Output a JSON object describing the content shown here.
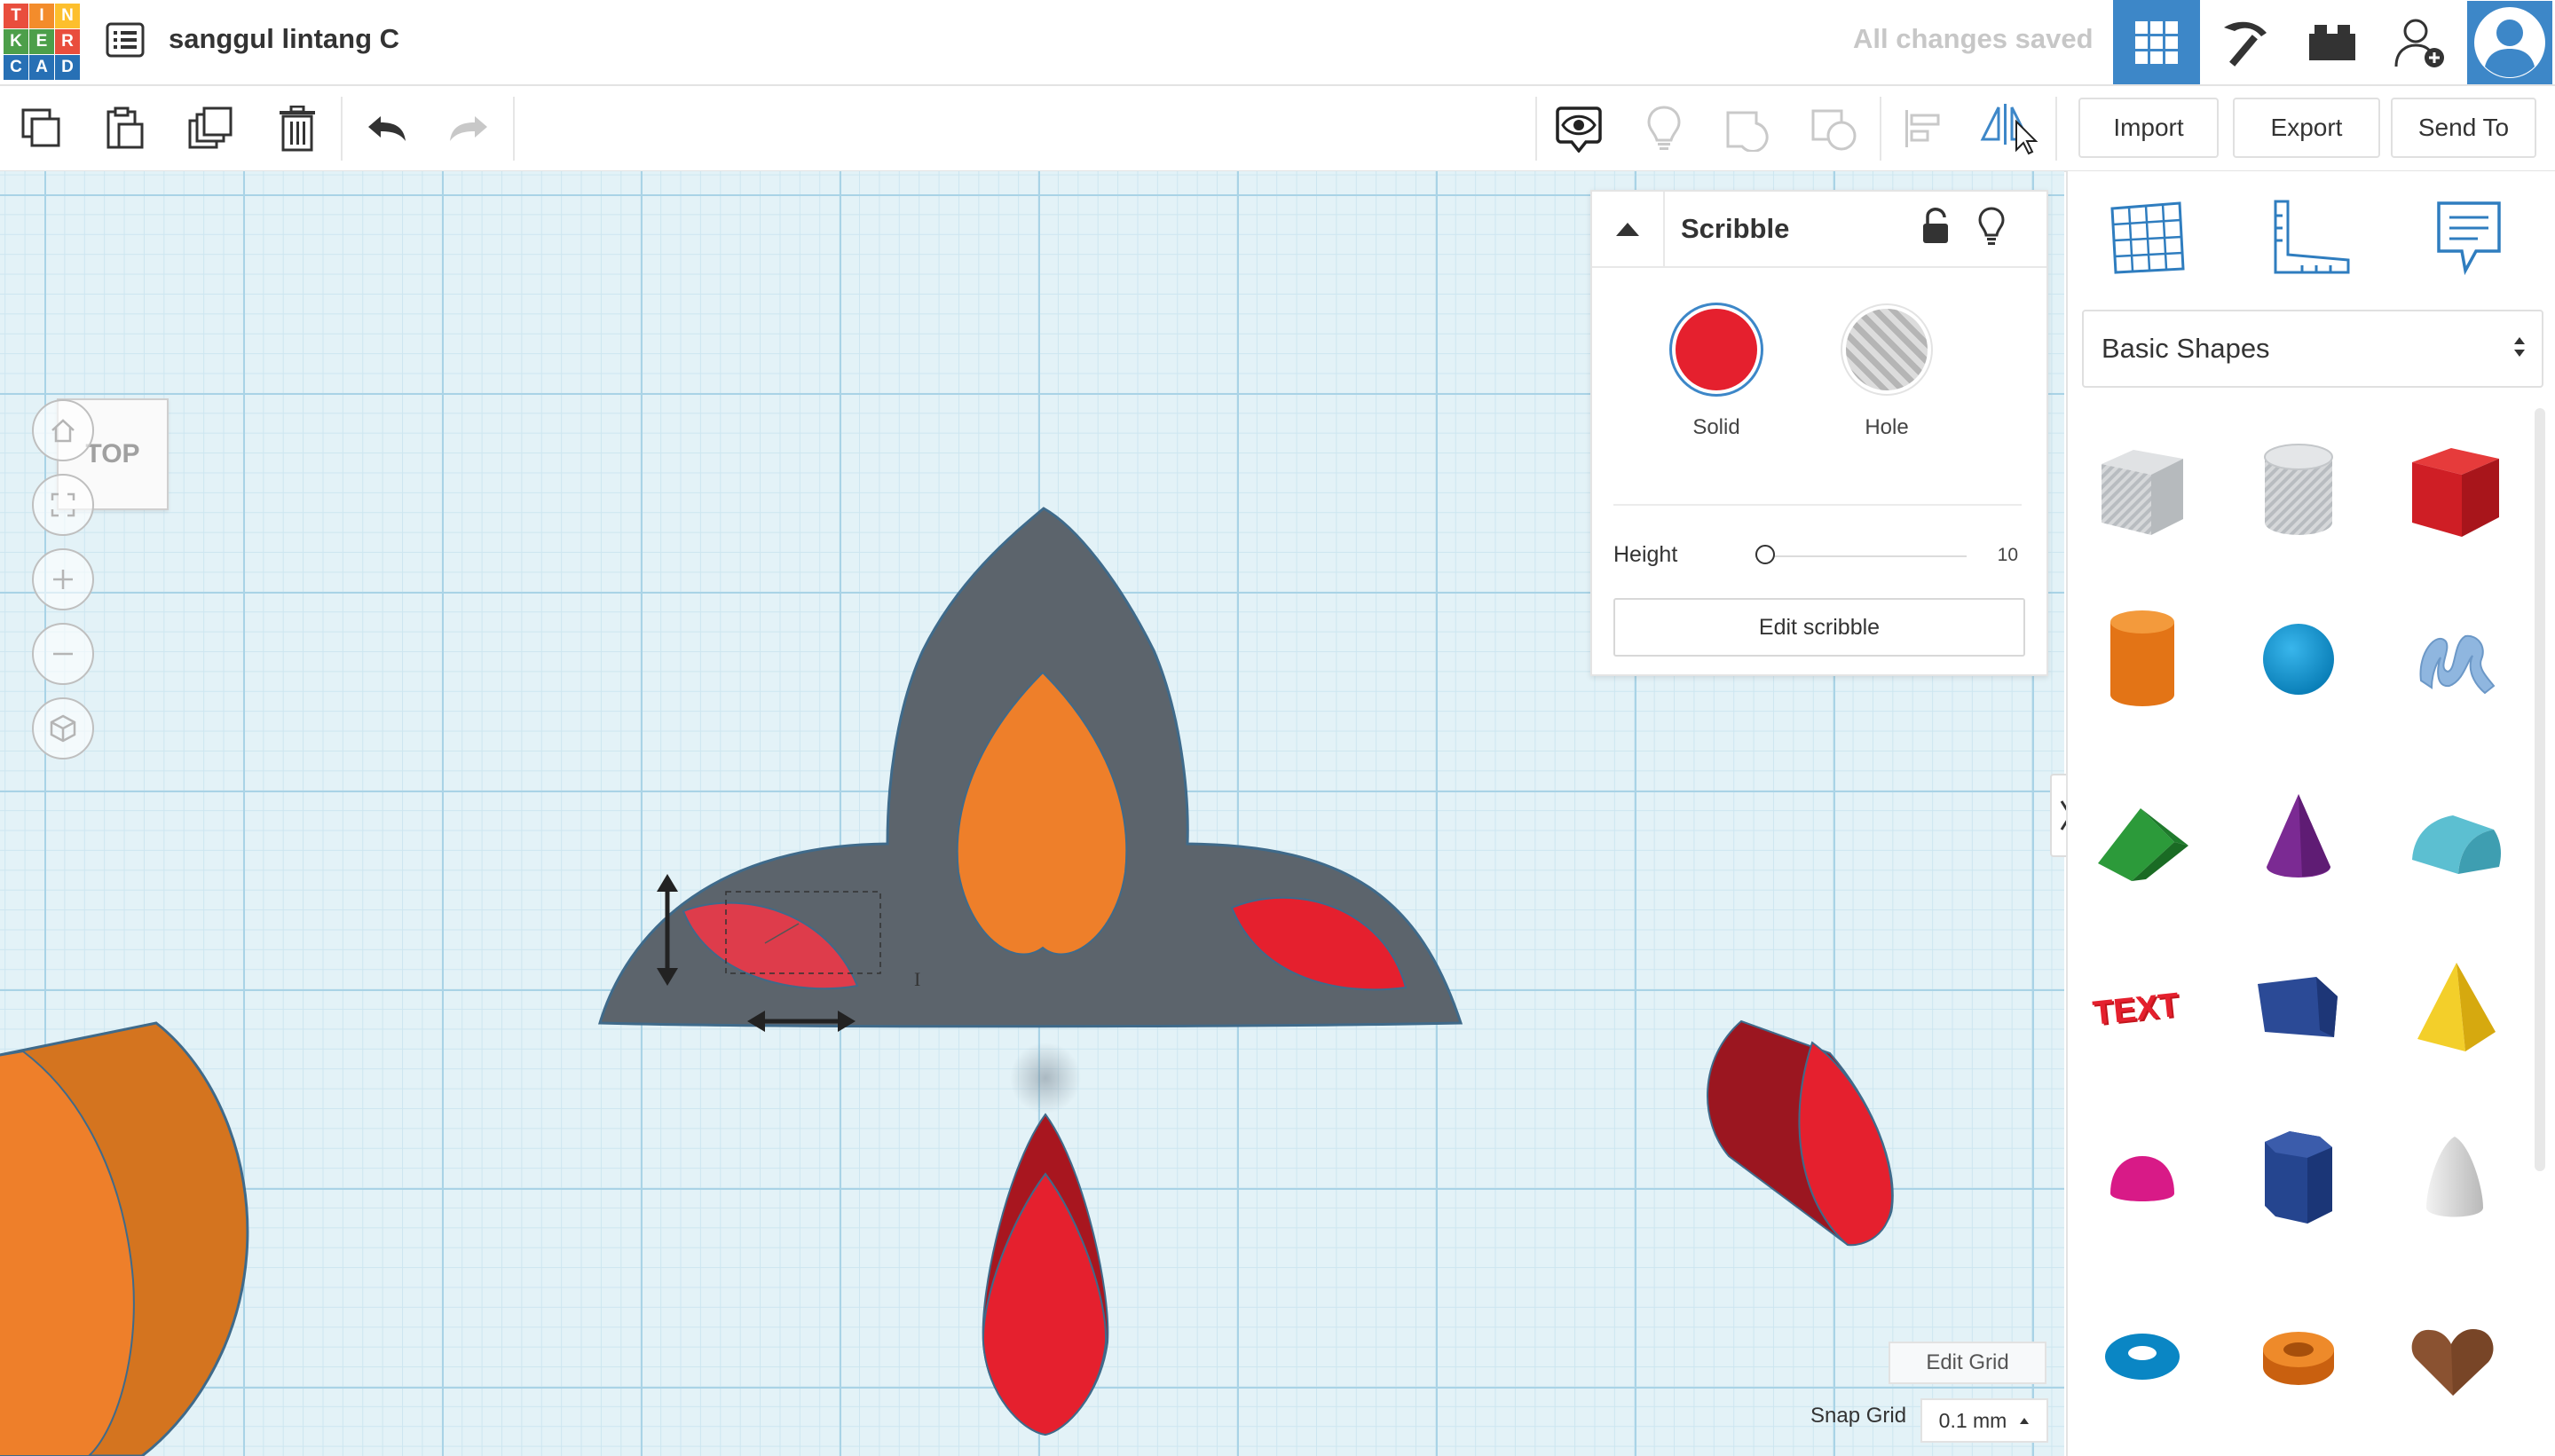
{
  "header": {
    "logo_letters": [
      "T",
      "I",
      "N",
      "K",
      "E",
      "R",
      "C",
      "A",
      "D"
    ],
    "logo_colors": [
      "#e94e3d",
      "#f38c2b",
      "#fdbf2d",
      "#4d9f4a",
      "#4d9f4a",
      "#e94e3d",
      "#2770b5",
      "#2770b5",
      "#2770b5"
    ],
    "document_title": "sanggul lintang C",
    "save_status": "All changes saved",
    "icons": [
      "grid-view-icon",
      "pickaxe-icon",
      "bricks-icon",
      "add-user-icon",
      "user-avatar-icon"
    ],
    "active_icon_color": "#3d87c8"
  },
  "toolbar": {
    "icons": [
      "copy-icon",
      "paste-icon",
      "duplicate-icon",
      "delete-icon",
      "undo-icon",
      "redo-icon",
      "show-all-icon",
      "light-bulb-icon",
      "group-icon",
      "ungroup-icon",
      "align-icon",
      "mirror-icon"
    ],
    "import_label": "Import",
    "export_label": "Export",
    "send_to_label": "Send To"
  },
  "viewport": {
    "view_label": "TOP",
    "nav_buttons": [
      "home-icon",
      "fit-view-icon",
      "zoom-in-icon",
      "zoom-out-icon",
      "perspective-icon"
    ]
  },
  "inspector": {
    "title": "Scribble",
    "solid_label": "Solid",
    "hole_label": "Hole",
    "solid_color": "#e5202e",
    "height_label": "Height",
    "height_value": "10",
    "height_fraction": 0.0,
    "edit_button": "Edit scribble"
  },
  "right_panel": {
    "tabs": [
      "workplane-icon",
      "ruler-icon",
      "notes-icon"
    ],
    "category": "Basic Shapes",
    "shapes": [
      "box-hole",
      "cylinder-hole",
      "box",
      "cylinder",
      "sphere",
      "scribble",
      "roof",
      "cone",
      "round-roof",
      "text",
      "wedge",
      "pyramid",
      "half-sphere",
      "polygon",
      "paraboloid",
      "torus",
      "tube",
      "heart"
    ]
  },
  "grid": {
    "edit_grid_label": "Edit Grid",
    "snap_label": "Snap Grid",
    "snap_value": "0.1 mm"
  }
}
